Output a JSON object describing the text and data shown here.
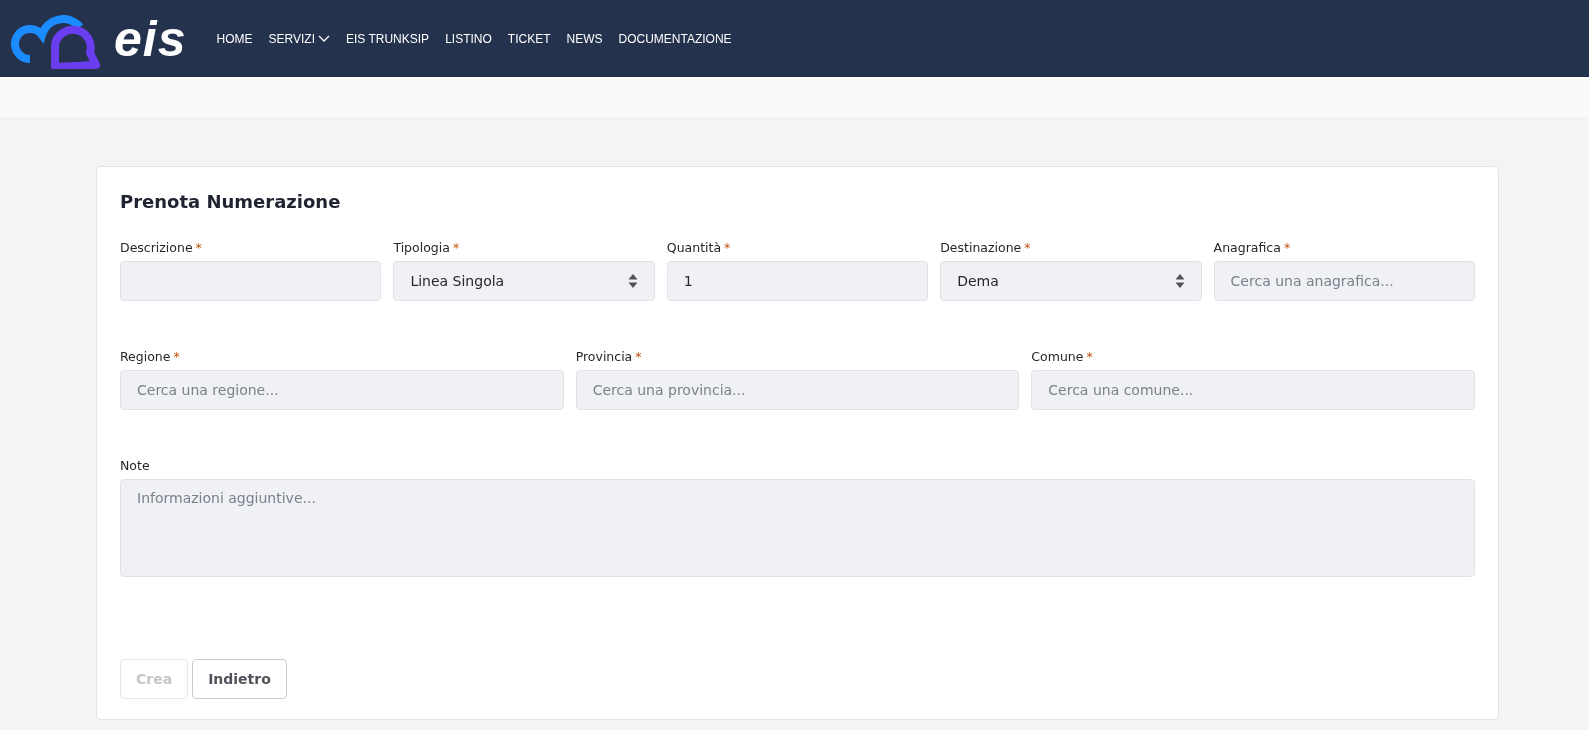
{
  "header": {
    "logo_text": "eis",
    "nav": [
      {
        "label": "HOME",
        "dropdown": false
      },
      {
        "label": "SERVIZI",
        "dropdown": true
      },
      {
        "label": "EIS TRUNKSIP",
        "dropdown": false
      },
      {
        "label": "LISTINO",
        "dropdown": false
      },
      {
        "label": "TICKET",
        "dropdown": false
      },
      {
        "label": "NEWS",
        "dropdown": false
      },
      {
        "label": "DOCUMENTAZIONE",
        "dropdown": false
      }
    ]
  },
  "form": {
    "title": "Prenota Numerazione",
    "rows": [
      {
        "fields": [
          {
            "kind": "text",
            "label": "Descrizione",
            "required_mark": "*"
          },
          {
            "kind": "select",
            "label": "Tipologia",
            "required_mark": "*",
            "value": "Linea Singola"
          },
          {
            "kind": "text",
            "label": "Quantità",
            "required_mark": "*",
            "value": "1"
          },
          {
            "kind": "select",
            "label": "Destinazione",
            "required_mark": "*",
            "value": "Dema"
          },
          {
            "kind": "text",
            "label": "Anagrafica",
            "required_mark": "*",
            "placeholder": "Cerca una anagrafica..."
          }
        ]
      },
      {
        "fields": [
          {
            "kind": "text",
            "label": "Regione",
            "required_mark": "*",
            "placeholder": "Cerca una regione..."
          },
          {
            "kind": "text",
            "label": "Provincia",
            "required_mark": "*",
            "placeholder": "Cerca una provincia..."
          },
          {
            "kind": "text",
            "label": "Comune",
            "required_mark": "*",
            "placeholder": "Cerca una comune..."
          }
        ]
      },
      {
        "fields": [
          {
            "kind": "textarea",
            "label": "Note",
            "placeholder": "Informazioni aggiuntive..."
          }
        ]
      }
    ],
    "buttons": [
      {
        "label": "Crea",
        "disabled": true
      },
      {
        "label": "Indietro",
        "disabled": false
      }
    ]
  }
}
